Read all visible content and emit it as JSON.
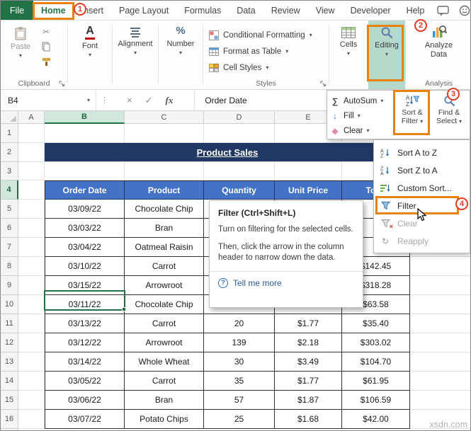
{
  "tabbar": {
    "file": "File",
    "tabs": [
      "Home",
      "Insert",
      "Page Layout",
      "Formulas",
      "Data",
      "Review",
      "View",
      "Developer",
      "Help"
    ]
  },
  "ribbon": {
    "paste_label": "Paste",
    "clipboard_group": "Clipboard",
    "font_group": "Font",
    "alignment_group": "Alignment",
    "number_group": "Number",
    "styles": {
      "conditional": "Conditional Formatting",
      "format_table": "Format as Table",
      "cell_styles": "Cell Styles",
      "group": "Styles"
    },
    "cells_label": "Cells",
    "editing_label": "Editing",
    "analyze": {
      "line1": "Analyze",
      "line2": "Data"
    },
    "analysis_group": "Analysis"
  },
  "annotations": {
    "step1": "1",
    "step2": "2",
    "step3": "3",
    "step4": "4"
  },
  "editing_menu": {
    "autosum": "AutoSum",
    "fill": "Fill",
    "clear": "Clear",
    "sort_filter": {
      "line1": "Sort &",
      "line2": "Filter"
    },
    "find_select": {
      "line1": "Find &",
      "line2": "Select"
    }
  },
  "sort_filter_menu": {
    "items": [
      {
        "label": "Sort A to Z"
      },
      {
        "label": "Sort Z to A"
      },
      {
        "label": "Custom Sort..."
      },
      {
        "label": "Filter"
      },
      {
        "label": "Clear"
      },
      {
        "label": "Reapply"
      }
    ]
  },
  "tooltip": {
    "title": "Filter (Ctrl+Shift+L)",
    "line1": "Turn on filtering for the selected cells.",
    "line2": "Then, click the arrow in the column header to narrow down the data.",
    "link": "Tell me more"
  },
  "formula_bar": {
    "name_box": "B4",
    "fx": "fx",
    "value": "Order Date"
  },
  "sheet": {
    "title": "Product Sales",
    "columns": [
      "A",
      "B",
      "C",
      "D",
      "E"
    ],
    "row_numbers": [
      "1",
      "2",
      "3",
      "4",
      "5",
      "6",
      "7",
      "8",
      "9",
      "10",
      "11",
      "12",
      "13",
      "14",
      "15",
      "16"
    ],
    "header": [
      "Order Date",
      "Product",
      "Quantity",
      "Unit Price",
      "Total"
    ],
    "rows": [
      [
        "03/09/22",
        "Chocolate Chip",
        "",
        "",
        ""
      ],
      [
        "03/03/22",
        "Bran",
        "",
        "",
        ""
      ],
      [
        "03/04/22",
        "Oatmeal Raisin",
        "",
        "",
        ""
      ],
      [
        "03/10/22",
        "Carrot",
        "",
        "",
        "$142.45"
      ],
      [
        "03/15/22",
        "Arrowroot",
        "",
        "",
        "$318.28"
      ],
      [
        "03/11/22",
        "Chocolate Chip",
        "",
        "",
        "$63.58"
      ],
      [
        "03/13/22",
        "Carrot",
        "20",
        "$1.77",
        "$35.40"
      ],
      [
        "03/12/22",
        "Arrowroot",
        "139",
        "$2.18",
        "$303.02"
      ],
      [
        "03/14/22",
        "Whole Wheat",
        "30",
        "$3.49",
        "$104.70"
      ],
      [
        "03/05/22",
        "Carrot",
        "35",
        "$1.77",
        "$61.95"
      ],
      [
        "03/06/22",
        "Bran",
        "57",
        "$1.87",
        "$106.59"
      ],
      [
        "03/07/22",
        "Potato Chips",
        "25",
        "$1.68",
        "$42.00"
      ]
    ],
    "watermark": "xsdn.com"
  },
  "icons": {
    "chevron": "▾",
    "sigma": "∑",
    "arrow_down": "↓",
    "eraser": "◆",
    "cut": "✂",
    "dots": "⋮",
    "cancel": "×",
    "check": "✓",
    "help": "?",
    "percent": "%",
    "font": "A",
    "letter_a": "A",
    "letter_z": "Z",
    "reapply": "↻"
  },
  "colors": {
    "excel_green": "#217346",
    "callout_orange": "#E8820C",
    "header_blue": "#4472C4",
    "banner_navy": "#1F3864",
    "link_blue": "#2B579A"
  }
}
